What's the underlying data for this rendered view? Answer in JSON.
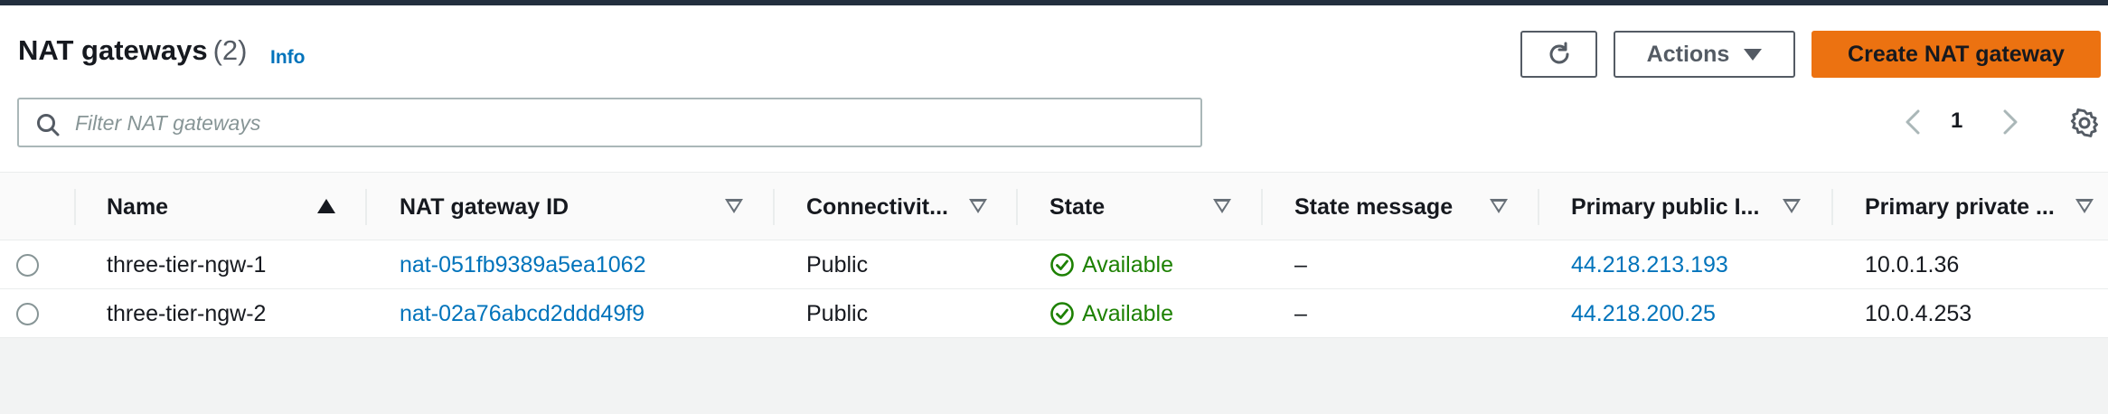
{
  "header": {
    "title": "NAT gateways",
    "count": "(2)",
    "info_label": "Info"
  },
  "toolbar": {
    "refresh_icon": "refresh-icon",
    "actions_label": "Actions",
    "create_label": "Create NAT gateway"
  },
  "search": {
    "placeholder": "Filter NAT gateways",
    "value": ""
  },
  "pagination": {
    "current_page": "1"
  },
  "table": {
    "columns": [
      {
        "label": "Name",
        "sort": "ascending"
      },
      {
        "label": "NAT gateway ID",
        "sort": "none"
      },
      {
        "label": "Connectivit...",
        "sort": "none"
      },
      {
        "label": "State",
        "sort": "none"
      },
      {
        "label": "State message",
        "sort": "none"
      },
      {
        "label": "Primary public I...",
        "sort": "none"
      },
      {
        "label": "Primary private ...",
        "sort": "none"
      }
    ],
    "rows": [
      {
        "name": "three-tier-ngw-1",
        "id": "nat-051fb9389a5ea1062",
        "connectivity": "Public",
        "state": "Available",
        "state_message": "–",
        "public_ip": "44.218.213.193",
        "private_ip": "10.0.1.36"
      },
      {
        "name": "three-tier-ngw-2",
        "id": "nat-02a76abcd2ddd49f9",
        "connectivity": "Public",
        "state": "Available",
        "state_message": "–",
        "public_ip": "44.218.200.25",
        "private_ip": "10.0.4.253"
      }
    ]
  },
  "colors": {
    "topbar": "#232f3e",
    "link": "#0073bb",
    "primary_button": "#ec7211",
    "status_success": "#1d8102"
  }
}
